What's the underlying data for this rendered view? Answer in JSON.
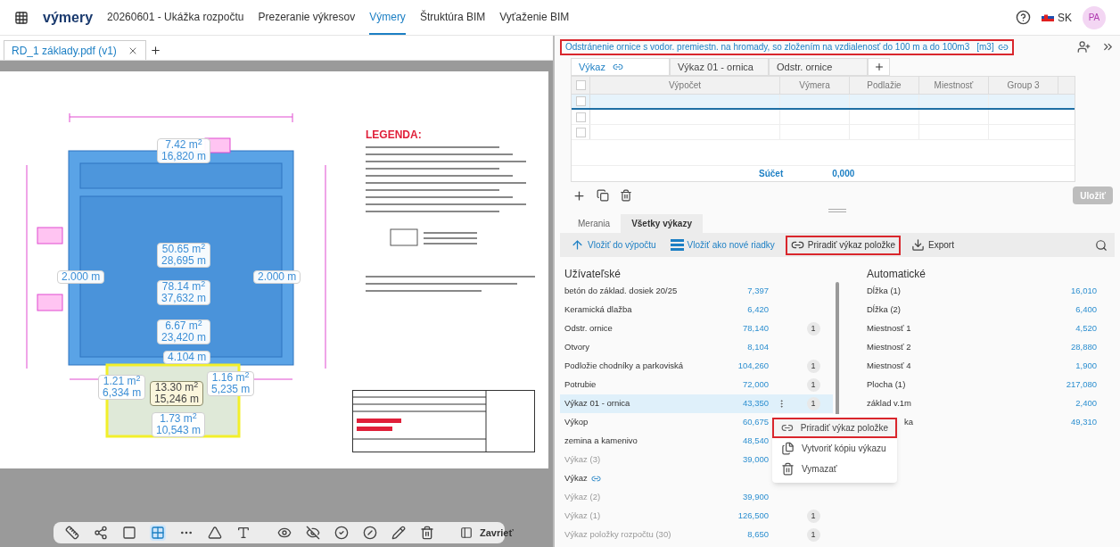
{
  "top_nav": {
    "brand": "výmery",
    "items": [
      {
        "label": "20260601 - Ukážka rozpočtu",
        "selected": false
      },
      {
        "label": "Prezeranie výkresov",
        "selected": false
      },
      {
        "label": "Výmery",
        "selected": true
      },
      {
        "label": "Štruktúra BIM",
        "selected": false
      },
      {
        "label": "Vyťaženie BIM",
        "selected": false
      }
    ],
    "language": "SK",
    "avatar": "PA"
  },
  "document_tab": {
    "label": "RD_1 základy.pdf (v1)"
  },
  "drawing": {
    "legend_title": "LEGENDA:",
    "labels": [
      {
        "lines": [
          "7.42 m$^{2}$",
          "16,820 m"
        ],
        "selected": false
      },
      {
        "lines": [
          "50.65 m$^{2}$",
          "28,695 m"
        ],
        "selected": false
      },
      {
        "lines": [
          "78.14 m$^{2}$",
          "37,632 m"
        ],
        "selected": false
      },
      {
        "lines": [
          "2.000 m"
        ],
        "selected": false
      },
      {
        "lines": [
          "2.000 m"
        ],
        "selected": false
      },
      {
        "lines": [
          "6.67 m$^{2}$",
          "23,420 m"
        ],
        "selected": false
      },
      {
        "lines": [
          "4.104 m"
        ],
        "selected": false
      },
      {
        "lines": [
          "1.21 m$^{2}$",
          "6,334 m"
        ],
        "selected": false
      },
      {
        "lines": [
          "13.30 m$^{2}$",
          "15,246 m"
        ],
        "selected": true
      },
      {
        "lines": [
          "1.16 m$^{2}$",
          "5,235 m"
        ],
        "selected": false
      },
      {
        "lines": [
          "1.73 m$^{2}$",
          "10,543 m"
        ],
        "selected": false
      }
    ]
  },
  "tools": [
    {
      "kind": "ruler",
      "selected": false
    },
    {
      "kind": "polyline",
      "selected": false
    },
    {
      "kind": "rectangle",
      "selected": false
    },
    {
      "kind": "area",
      "selected": true
    },
    {
      "kind": "points",
      "selected": false
    },
    {
      "kind": "angle",
      "selected": false
    },
    {
      "kind": "text",
      "selected": false
    },
    {
      "kind": "eye",
      "selected": false
    },
    {
      "kind": "eye-off",
      "selected": false
    },
    {
      "kind": "check",
      "selected": false
    },
    {
      "kind": "slash",
      "selected": false
    },
    {
      "kind": "pencil",
      "selected": false
    },
    {
      "kind": "trash",
      "selected": false
    }
  ],
  "close_button": "Zavrieť",
  "item": {
    "title": "Odstránenie ornice s vodor. premiestn. na hromady, so zložením na vzdialenosť do 100 m a do 100m3",
    "unit": "[m3]",
    "outlined": true
  },
  "sheet_tabs": [
    {
      "label": "Výkaz",
      "linked": true,
      "selected": true
    },
    {
      "label": "Výkaz 01 - ornica",
      "linked": false,
      "selected": false
    },
    {
      "label": "Odstr. ornice",
      "linked": false,
      "selected": false
    }
  ],
  "table": {
    "columns": [
      "Výpočet",
      "Výmera",
      "Podlažie",
      "Miestnosť",
      "Group 3"
    ],
    "rows": [
      {
        "selected": true,
        "checked": false
      },
      {
        "selected": false,
        "checked": false
      },
      {
        "selected": false,
        "checked": false
      }
    ],
    "all_checked": false,
    "sum_label": "Súčet",
    "sum_value": "0,000"
  },
  "save_button": {
    "label": "Uložiť",
    "disabled": true
  },
  "panel_tabs": [
    {
      "label": "Merania",
      "selected": false
    },
    {
      "label": "Všetky výkazy",
      "selected": true
    }
  ],
  "actions": [
    {
      "kind": "insert",
      "label": "Vložiť do výpočtu",
      "primary": true,
      "outlined": false
    },
    {
      "kind": "rows",
      "label": "Vložiť ako nové riadky",
      "primary": true,
      "outlined": false
    },
    {
      "kind": "link",
      "label": "Priradiť výkaz položke",
      "primary": false,
      "outlined": true
    },
    {
      "kind": "export",
      "label": "Export",
      "primary": false,
      "outlined": false
    }
  ],
  "user_reports": {
    "title": "Užívateľské",
    "items": [
      {
        "name": "betón do základ. dosiek 20/25",
        "value": "7,397",
        "muted": false,
        "selected": false
      },
      {
        "name": "Keramická dlažba",
        "value": "6,420",
        "muted": false,
        "selected": false
      },
      {
        "name": "Odstr. ornice",
        "value": "78,140",
        "count": "1",
        "muted": false,
        "selected": false
      },
      {
        "name": "Otvory",
        "value": "8,104",
        "muted": false,
        "selected": false
      },
      {
        "name": "Podložie chodníky a parkoviská",
        "value": "104,260",
        "count": "1",
        "muted": false,
        "selected": false
      },
      {
        "name": "Potrubie",
        "value": "72,000",
        "count": "1",
        "muted": false,
        "selected": false
      },
      {
        "name": "Výkaz 01 - ornica",
        "value": "43,350",
        "count": "1",
        "muted": false,
        "selected": true
      },
      {
        "name": "Výkop",
        "value": "60,675",
        "muted": false,
        "selected": false
      },
      {
        "name": "zemina a kamenivo",
        "value": "48,540",
        "muted": false,
        "selected": false
      },
      {
        "name": "Výkaz (3)",
        "value": "39,000",
        "muted": true,
        "selected": false
      },
      {
        "name": "Výkaz",
        "linked": true,
        "muted": false,
        "selected": false
      },
      {
        "name": "Výkaz (2)",
        "value": "39,900",
        "muted": true,
        "selected": false
      },
      {
        "name": "Výkaz (1)",
        "value": "126,500",
        "count": "1",
        "muted": true,
        "selected": false
      },
      {
        "name": "Výkaz položky rozpočtu (30)",
        "value": "8,650",
        "count": "1",
        "muted": true,
        "selected": false
      }
    ]
  },
  "auto_reports": {
    "title": "Automatické",
    "items": [
      {
        "name": "Dĺžka (1)",
        "value": "16,010"
      },
      {
        "name": "Dĺžka (2)",
        "value": "6,400"
      },
      {
        "name": "Miestnosť 1",
        "value": "4,520"
      },
      {
        "name": "Miestnosť 2",
        "value": "28,880"
      },
      {
        "name": "Miestnosť 4",
        "value": "1,900"
      },
      {
        "name": "Plocha (1)",
        "value": "217,080"
      },
      {
        "name": "základ v.1m",
        "value": "2,400"
      },
      {
        "name": "ka",
        "value": "49,310",
        "covered": true
      }
    ]
  },
  "context_menu": [
    {
      "kind": "link",
      "label": "Priradiť výkaz položke",
      "selected": true
    },
    {
      "kind": "copy",
      "label": "Vytvoriť kópiu výkazu",
      "selected": false
    },
    {
      "kind": "delete",
      "label": "Vymazať",
      "selected": false
    }
  ]
}
